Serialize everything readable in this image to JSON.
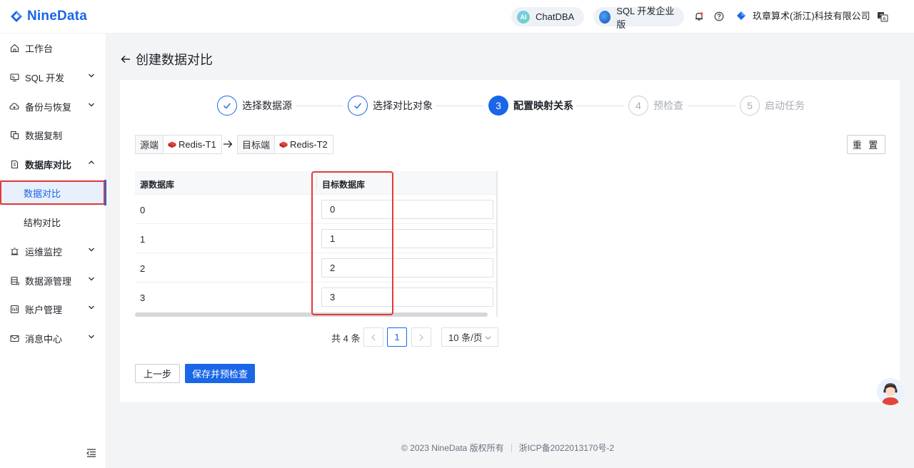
{
  "header": {
    "logo_text": "NineData",
    "chatdba_label": "ChatDBA",
    "chatdba_badge": "AI",
    "edition_label": "SQL 开发企业版",
    "company_name": "玖章算术(浙江)科技有限公司"
  },
  "sidebar": {
    "items": [
      {
        "label": "工作台"
      },
      {
        "label": "SQL 开发"
      },
      {
        "label": "备份与恢复"
      },
      {
        "label": "数据复制"
      },
      {
        "label": "数据库对比"
      },
      {
        "label": "运维监控"
      },
      {
        "label": "数据源管理"
      },
      {
        "label": "账户管理"
      },
      {
        "label": "消息中心"
      }
    ],
    "sub_items": [
      {
        "label": "数据对比"
      },
      {
        "label": "结构对比"
      }
    ]
  },
  "page": {
    "title": "创建数据对比"
  },
  "steps": [
    {
      "num": "1",
      "label": "选择数据源",
      "status": "done"
    },
    {
      "num": "2",
      "label": "选择对比对象",
      "status": "done"
    },
    {
      "num": "3",
      "label": "配置映射关系",
      "status": "current"
    },
    {
      "num": "4",
      "label": "预检查",
      "status": "todo"
    },
    {
      "num": "5",
      "label": "启动任务",
      "status": "todo"
    }
  ],
  "source": {
    "key": "源端",
    "value": "Redis-T1"
  },
  "target": {
    "key": "目标端",
    "value": "Redis-T2"
  },
  "reset_label": "重 置",
  "table": {
    "headers": [
      "源数据库",
      "目标数据库"
    ],
    "rows": [
      {
        "source": "0",
        "target": "0"
      },
      {
        "source": "1",
        "target": "1"
      },
      {
        "source": "2",
        "target": "2"
      },
      {
        "source": "3",
        "target": "3"
      }
    ]
  },
  "pagination": {
    "total_text": "共 4 条",
    "prev": "<",
    "current_page": "1",
    "next": ">",
    "page_size": "10 条/页"
  },
  "actions": {
    "prev_step": "上一步",
    "save_check": "保存并预检查"
  },
  "footer": {
    "copyright": "© 2023 NineData 版权所有",
    "icp": "浙ICP备2022013170号-2"
  },
  "colors": {
    "brand": "#1a66e8",
    "highlight": "#e53935"
  }
}
